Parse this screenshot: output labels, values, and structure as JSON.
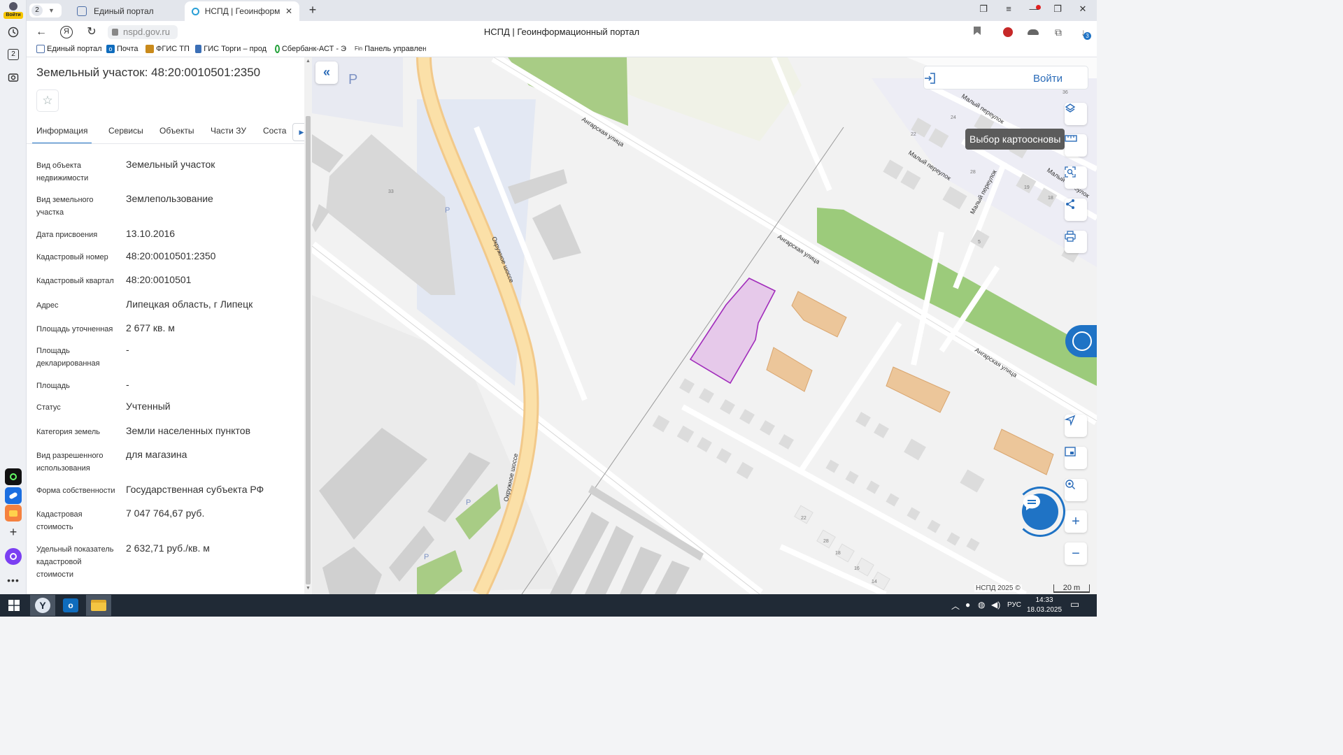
{
  "browser": {
    "login_label": "Войти",
    "left_badge": "2",
    "tab_count": "2",
    "tabs": [
      {
        "label": "Единый портал"
      },
      {
        "label": "НСПД | Геоинформаци"
      }
    ],
    "url": "nspd.gov.ru",
    "page_title": "НСПД | Геоинформационный портал",
    "downloads_badge": "3",
    "bookmarks": [
      {
        "label": "Единый портал"
      },
      {
        "label": "Почта"
      },
      {
        "label": "ФГИС ТП"
      },
      {
        "label": "ГИС Торги – прод"
      },
      {
        "label": "Сбербанк-АСТ - Э"
      },
      {
        "label": "Панель управлен"
      }
    ]
  },
  "panel": {
    "title": "Земельный участок: 48:20:0010501:2350",
    "tabs": [
      "Информация",
      "Сервисы",
      "Объекты",
      "Части ЗУ",
      "Соста"
    ],
    "fields": [
      {
        "label": "Вид объекта недвижимости",
        "value": "Земельный участок"
      },
      {
        "label": "Вид земельного участка",
        "value": "Землепользование"
      },
      {
        "label": "Дата присвоения",
        "value": "13.10.2016"
      },
      {
        "label": "Кадастровый номер",
        "value": "48:20:0010501:2350"
      },
      {
        "label": "Кадастровый квартал",
        "value": "48:20:0010501"
      },
      {
        "label": "Адрес",
        "value": "Липецкая область, г Липецк"
      },
      {
        "label": "Площадь уточненная",
        "value": "2 677 кв. м"
      },
      {
        "label": "Площадь декларированная",
        "value": "-"
      },
      {
        "label": "Площадь",
        "value": "-"
      },
      {
        "label": "Статус",
        "value": "Учтенный"
      },
      {
        "label": "Категория земель",
        "value": "Земли населенных пунктов"
      },
      {
        "label": "Вид разрешенного использования",
        "value": "для магазина"
      },
      {
        "label": "Форма собственности",
        "value": "Государственная субъекта РФ"
      },
      {
        "label": "Кадастровая стоимость",
        "value": "7 047 764,67 руб."
      },
      {
        "label": "Удельный показатель кадастровой стоимости",
        "value": "2 632,71 руб./кв. м"
      }
    ]
  },
  "map": {
    "login_label": "Войти",
    "tooltip": "Выбор картоосновы",
    "attribution": "НСПД 2025 ©",
    "scale_label": "20 m",
    "parking_label": "P",
    "streets": {
      "angarskaya": "Ангарская улица",
      "okruzhnoe": "Окружное шоссе",
      "maly": "Малый переулок"
    },
    "house_numbers": [
      "33",
      "36",
      "24",
      "22",
      "28",
      "19",
      "18",
      "5",
      "22",
      "28",
      "18",
      "16",
      "14"
    ],
    "tools": [
      "layers-icon",
      "ruler-icon",
      "search-area-icon",
      "share-icon",
      "print-icon",
      "locate-icon",
      "minimap-icon",
      "geo-search-icon",
      "zoom-in-icon",
      "zoom-out-icon"
    ]
  },
  "taskbar": {
    "language": "РУС",
    "time": "14:33",
    "date": "18.03.2025"
  }
}
